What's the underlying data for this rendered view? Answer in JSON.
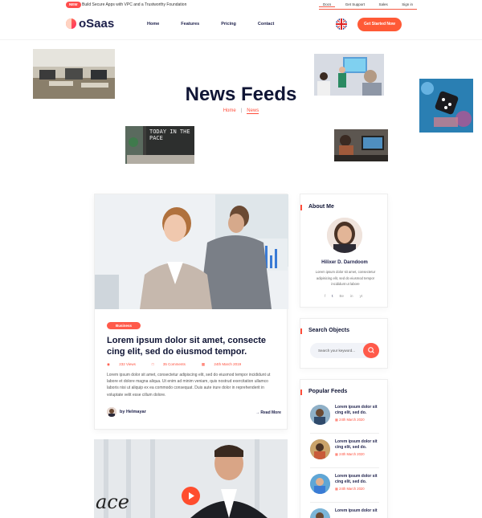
{
  "topbar": {
    "badge": "NEW",
    "message": "Build Secure Apps with VPC and a Trustworthy Foundation",
    "links": [
      "Docs",
      "Get Support",
      "Sales",
      "Sign in"
    ]
  },
  "header": {
    "logo": "oSaas",
    "nav": [
      "Home",
      "Features",
      "Pricing",
      "Contact"
    ],
    "cta": "Get Started Now"
  },
  "hero": {
    "title": "News Feeds",
    "breadcrumb_home": "Home",
    "breadcrumb_sep": "|",
    "breadcrumb_current": "News",
    "photo_text": "TODAY IN THE PACE"
  },
  "post": {
    "category": "Business",
    "title": "Lorem ipsum dolor sit amet, consecte cing elit, sed do eiusmod tempor.",
    "views": "232 Views",
    "comments": "35 Comments",
    "date": "24th March 2019",
    "excerpt": "Lorem ipsum dolor sit amet, consectetur adipiscing elit, sed do eiusmod tempor incididunt ut labore et dolore magna aliqua. Ut enim ad minim veniam, quis nostrud exercitation ullamco laboris nisi ut aliquip ex ea commodo consequat. Duis aute irure dolor in reprehenderit in voluptate velit esse cillum dolore.",
    "author": "by Helmayar",
    "read_more": "Read More",
    "second_post_text": "ace"
  },
  "sidebar": {
    "about": {
      "title": "About Me",
      "name": "Hilixer D. Darndoom",
      "text": "Lorem ipsum dolor sit amet, consectetur adipisicing elit, sed do eiusmod tempor incididunt ut labore",
      "socials": [
        "f",
        "t",
        "Be",
        "in",
        "yt"
      ]
    },
    "search": {
      "title": "Search Objects",
      "placeholder": "Search your keyword..."
    },
    "popular": {
      "title": "Popular Feeds",
      "items": [
        {
          "title": "Lorem ipsum dolor sit cing elit, sed do.",
          "date": "24th March 2020"
        },
        {
          "title": "Lorem ipsum dolor sit cing elit, sed do.",
          "date": "24th March 2020"
        },
        {
          "title": "Lorem ipsum dolor sit cing elit, sed do.",
          "date": "24th March 2020"
        },
        {
          "title": "Lorem ipsum dolor sit",
          "date": ""
        }
      ]
    }
  },
  "colors": {
    "accent": "#ff5a36",
    "heading": "#101535"
  }
}
